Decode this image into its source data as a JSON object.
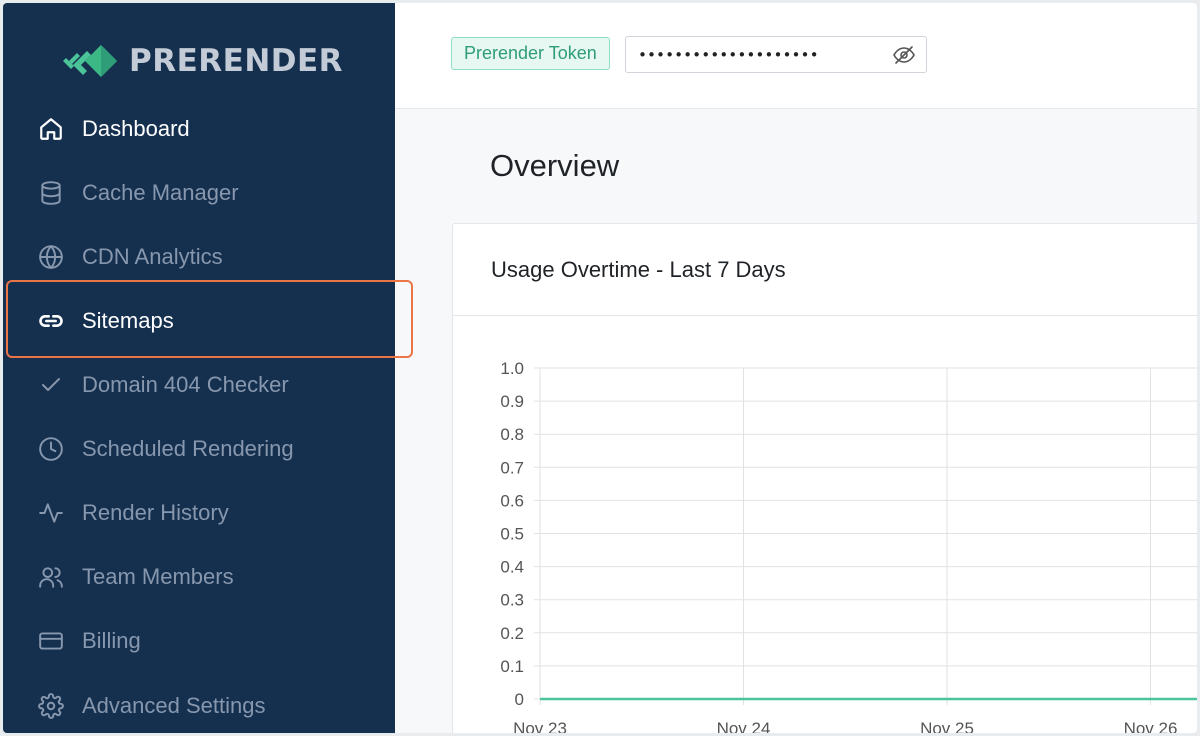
{
  "app": {
    "name": "PRERENDER"
  },
  "sidebar": {
    "items": [
      {
        "id": "dashboard",
        "label": "Dashboard",
        "icon": "home-icon",
        "active": true
      },
      {
        "id": "cache-manager",
        "label": "Cache Manager",
        "icon": "database-icon",
        "active": false
      },
      {
        "id": "cdn-analytics",
        "label": "CDN Analytics",
        "icon": "globe-icon",
        "active": false
      },
      {
        "id": "sitemaps",
        "label": "Sitemaps",
        "icon": "link-icon",
        "active": true
      },
      {
        "id": "domain-404-checker",
        "label": "Domain 404 Checker",
        "icon": "check-icon",
        "active": false
      },
      {
        "id": "scheduled-rendering",
        "label": "Scheduled Rendering",
        "icon": "clock-icon",
        "active": false
      },
      {
        "id": "render-history",
        "label": "Render History",
        "icon": "activity-icon",
        "active": false
      },
      {
        "id": "team-members",
        "label": "Team Members",
        "icon": "users-icon",
        "active": false
      },
      {
        "id": "billing",
        "label": "Billing",
        "icon": "credit-card-icon",
        "active": false
      },
      {
        "id": "advanced-settings",
        "label": "Advanced Settings",
        "icon": "gear-icon",
        "active": false
      }
    ]
  },
  "topbar": {
    "token_label": "Prerender Token",
    "token_value": "••••••••••••••••••••",
    "toggle_icon": "eye-off-icon"
  },
  "main": {
    "title": "Overview",
    "card_title": "Usage Overtime - Last 7 Days"
  },
  "colors": {
    "sidebar_bg": "#15304f",
    "accent_green": "#4cc49a",
    "highlight": "#ea7547"
  },
  "chart_data": {
    "type": "line",
    "title": "Usage Overtime - Last 7 Days",
    "x": [
      "Nov 23",
      "Nov 24",
      "Nov 25",
      "Nov 26"
    ],
    "series": [
      {
        "values": [
          0,
          0,
          0,
          0
        ],
        "color": "#4cc49a"
      }
    ],
    "ylim": [
      0,
      1.0
    ],
    "yticks": [
      "1.0",
      "0.9",
      "0.8",
      "0.7",
      "0.6",
      "0.5",
      "0.4",
      "0.3",
      "0.2",
      "0.1",
      "0"
    ],
    "grid": true,
    "xlabel": "",
    "ylabel": ""
  }
}
